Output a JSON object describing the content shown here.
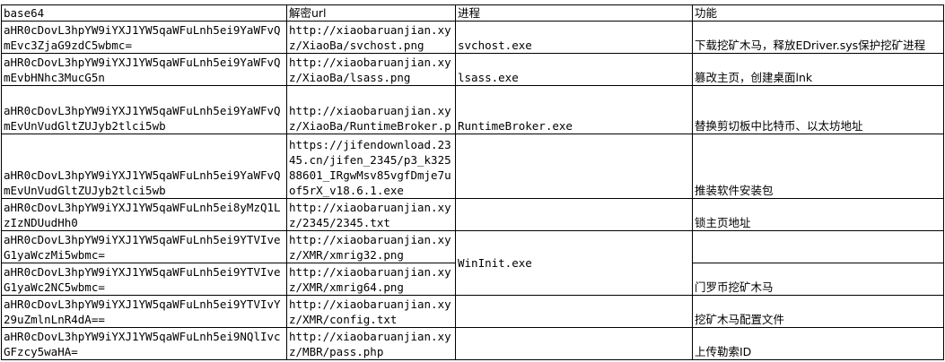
{
  "headers": {
    "base64": "base64",
    "url": "解密url",
    "process": "进程",
    "function": "功能"
  },
  "rows": [
    {
      "base64": "aHR0cDovL3hpYW9iYXJ1YW5qaWFuLnh5ei9YaWFvQmEvc3ZjaG9zdC5wbmc=",
      "url": "http://xiaobaruanjian.xyz/XiaoBa/svchost.png",
      "process": "svchost.exe",
      "function": "下载挖矿木马，释放EDriver.sys保护挖矿进程"
    },
    {
      "base64": "aHR0cDovL3hpYW9iYXJ1YW5qaWFuLnh5ei9YaWFvQmEvbHNhc3MucG5n",
      "url": "http://xiaobaruanjian.xyz/XiaoBa/lsass.png",
      "process": "lsass.exe",
      "function": "篡改主页，创建桌面lnk"
    },
    {
      "base64": "aHR0cDovL3hpYW9iYXJ1YW5qaWFuLnh5ei9YaWFvQmEvUnVudGltZUJyb2tlci5wb",
      "url": "http://xiaobaruanjian.xyz/XiaoBa/RuntimeBroker.p",
      "process": "RuntimeBroker.exe",
      "function": "替换剪切板中比特币、以太坊地址"
    },
    {
      "base64": "aHR0cDovL3hpYW9iYXJ1YW5qaWFuLnh5ei9YaWFvQmEvUnVudGltZUJyb2tlci5wb",
      "url": "https://jifendownload.2345.cn/jifen_2345/p3_k32588601_IRgwMsv85vgfDmje7uof5rX_v18.6.1.exe",
      "process": "",
      "function": "推装软件安装包"
    },
    {
      "base64": "aHR0cDovL3hpYW9iYXJ1YW5qaWFuLnh5ei8yMzQ1LzIzNDUudHh0",
      "url": "http://xiaobaruanjian.xyz/2345/2345.txt",
      "process": "",
      "function": "锁主页地址"
    },
    {
      "base64": "aHR0cDovL3hpYW9iYXJ1YW5qaWFuLnh5ei9YTVIveG1yaWczMi5wbmc=",
      "url": "http://xiaobaruanjian.xyz/XMR/xmrig32.png",
      "function": ""
    },
    {
      "base64": "aHR0cDovL3hpYW9iYXJ1YW5qaWFuLnh5ei9YTVIveG1yaWc2NC5wbmc=",
      "url": "http://xiaobaruanjian.xyz/XMR/xmrig64.png",
      "function": "门罗币挖矿木马"
    },
    {
      "base64": "aHR0cDovL3hpYW9iYXJ1YW5qaWFuLnh5ei9YTVIvY29uZmlnLnR4dA==",
      "url": "http://xiaobaruanjian.xyz/XMR/config.txt",
      "process": "",
      "function": "挖矿木马配置文件"
    },
    {
      "base64": "aHR0cDovL3hpYW9iYXJ1YW5qaWFuLnh5ei9NQlIvcGFzcy5waHA=",
      "url": "http://xiaobaruanjian.xyz/MBR/pass.php",
      "process": "",
      "function": "上传勒索ID"
    }
  ],
  "merged_process": "WinInit.exe"
}
